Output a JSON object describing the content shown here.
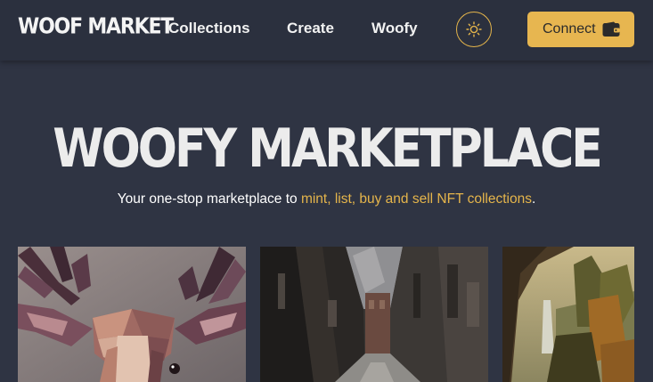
{
  "brand": {
    "logo_text": "WOOF MARKET"
  },
  "nav": {
    "links": [
      {
        "label": "Collections"
      },
      {
        "label": "Create"
      },
      {
        "label": "Woofy"
      }
    ],
    "theme_icon": "sun-icon",
    "connect_label": "Connect",
    "connect_icon": "wallet-icon"
  },
  "hero": {
    "title": "WOOFY MARKETPLACE",
    "subtitle_prefix": "Your one-stop marketplace to ",
    "subtitle_accent": "mint, list, buy and sell NFT collections",
    "subtitle_suffix": "."
  },
  "colors": {
    "background": "#2f3443",
    "header": "#2b303e",
    "accent": "#e5b54b",
    "button": "#e7b650"
  }
}
